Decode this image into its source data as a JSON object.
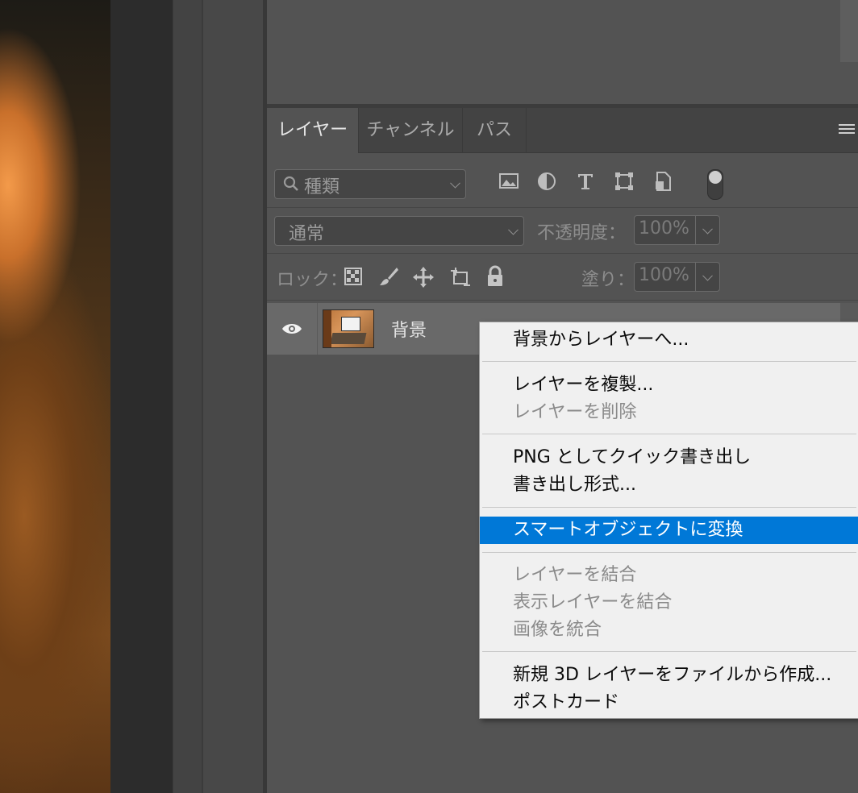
{
  "layers_panel": {
    "tabs": [
      {
        "label": "レイヤー",
        "active": true
      },
      {
        "label": "チャンネル",
        "active": false
      },
      {
        "label": "パス",
        "active": false
      }
    ],
    "filter": {
      "placeholder": "種類"
    },
    "blend_mode": "通常",
    "opacity_label": "不透明度：",
    "opacity_value": "100%",
    "lock_label": "ロック：",
    "fill_label": "塗り：",
    "fill_value": "100%",
    "layers": [
      {
        "name": "背景",
        "visible": true,
        "locked": true
      }
    ]
  },
  "context_menu": {
    "items": [
      {
        "label": "背景からレイヤーへ...",
        "enabled": true
      },
      {
        "label": "レイヤーを複製...",
        "enabled": true
      },
      {
        "label": "レイヤーを削除",
        "enabled": false
      },
      {
        "label": "PNG としてクイック書き出し",
        "enabled": true
      },
      {
        "label": "書き出し形式...",
        "enabled": true
      },
      {
        "label": "スマートオブジェクトに変換",
        "enabled": true,
        "highlighted": true
      },
      {
        "label": "レイヤーを結合",
        "enabled": false
      },
      {
        "label": "表示レイヤーを結合",
        "enabled": false
      },
      {
        "label": "画像を統合",
        "enabled": false
      },
      {
        "label": "新規 3D レイヤーをファイルから作成...",
        "enabled": true
      },
      {
        "label": "ポストカード",
        "enabled": true
      }
    ]
  },
  "colors": {
    "panel_bg": "#535353",
    "menu_highlight": "#0078d7",
    "menu_bg": "#f0f0f0"
  }
}
